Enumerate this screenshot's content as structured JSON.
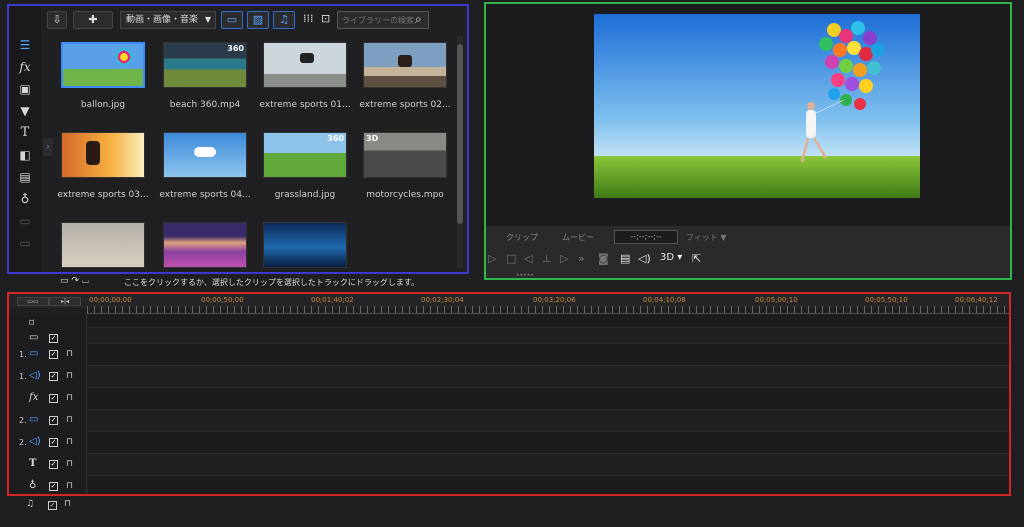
{
  "library": {
    "media_filter": "動画・画像・音楽",
    "search_placeholder": "ライブラリーの検索",
    "items": [
      {
        "label": "ballon.jpg",
        "badge": ""
      },
      {
        "label": "beach 360.mp4",
        "badge": "360"
      },
      {
        "label": "extreme sports 01...",
        "badge": ""
      },
      {
        "label": "extreme sports 02...",
        "badge": ""
      },
      {
        "label": "extreme sports 03...",
        "badge": ""
      },
      {
        "label": "extreme sports 04...",
        "badge": ""
      },
      {
        "label": "grassland.jpg",
        "badge": "360"
      },
      {
        "label": "motorcycles.mpo",
        "badge": "3D"
      },
      {
        "label": "",
        "badge": ""
      },
      {
        "label": "",
        "badge": ""
      },
      {
        "label": "",
        "badge": ""
      }
    ],
    "hint": "ここをクリックするか、選択したクリップを選択したトラックにドラッグします。"
  },
  "preview": {
    "tab_clip": "クリップ",
    "tab_movie": "ムービー",
    "timecode": "--;--;--;--",
    "fit": "フィット",
    "mode_3d": "3D"
  },
  "timeline": {
    "ruler": [
      "00;00;00;00",
      "00;00;50;00",
      "00;01;40;02",
      "00;02;30;04",
      "00;03;20;06",
      "00;04;10;08",
      "00;05;00;10",
      "00;05;50;10",
      "00;06;40;12"
    ],
    "tracks": [
      {
        "num": "",
        "icon": "chapter"
      },
      {
        "num": "",
        "icon": "subtitle"
      },
      {
        "num": "1.",
        "icon": "video"
      },
      {
        "num": "1.",
        "icon": "audio"
      },
      {
        "num": "",
        "icon": "fx"
      },
      {
        "num": "2.",
        "icon": "video"
      },
      {
        "num": "2.",
        "icon": "audio"
      },
      {
        "num": "",
        "icon": "title"
      },
      {
        "num": "",
        "icon": "voice"
      },
      {
        "num": "",
        "icon": "music"
      }
    ]
  },
  "colors": {
    "library_border": "#3a3ad0",
    "preview_border": "#2fb84a",
    "timeline_border": "#d42626",
    "accent": "#3c8bff"
  }
}
